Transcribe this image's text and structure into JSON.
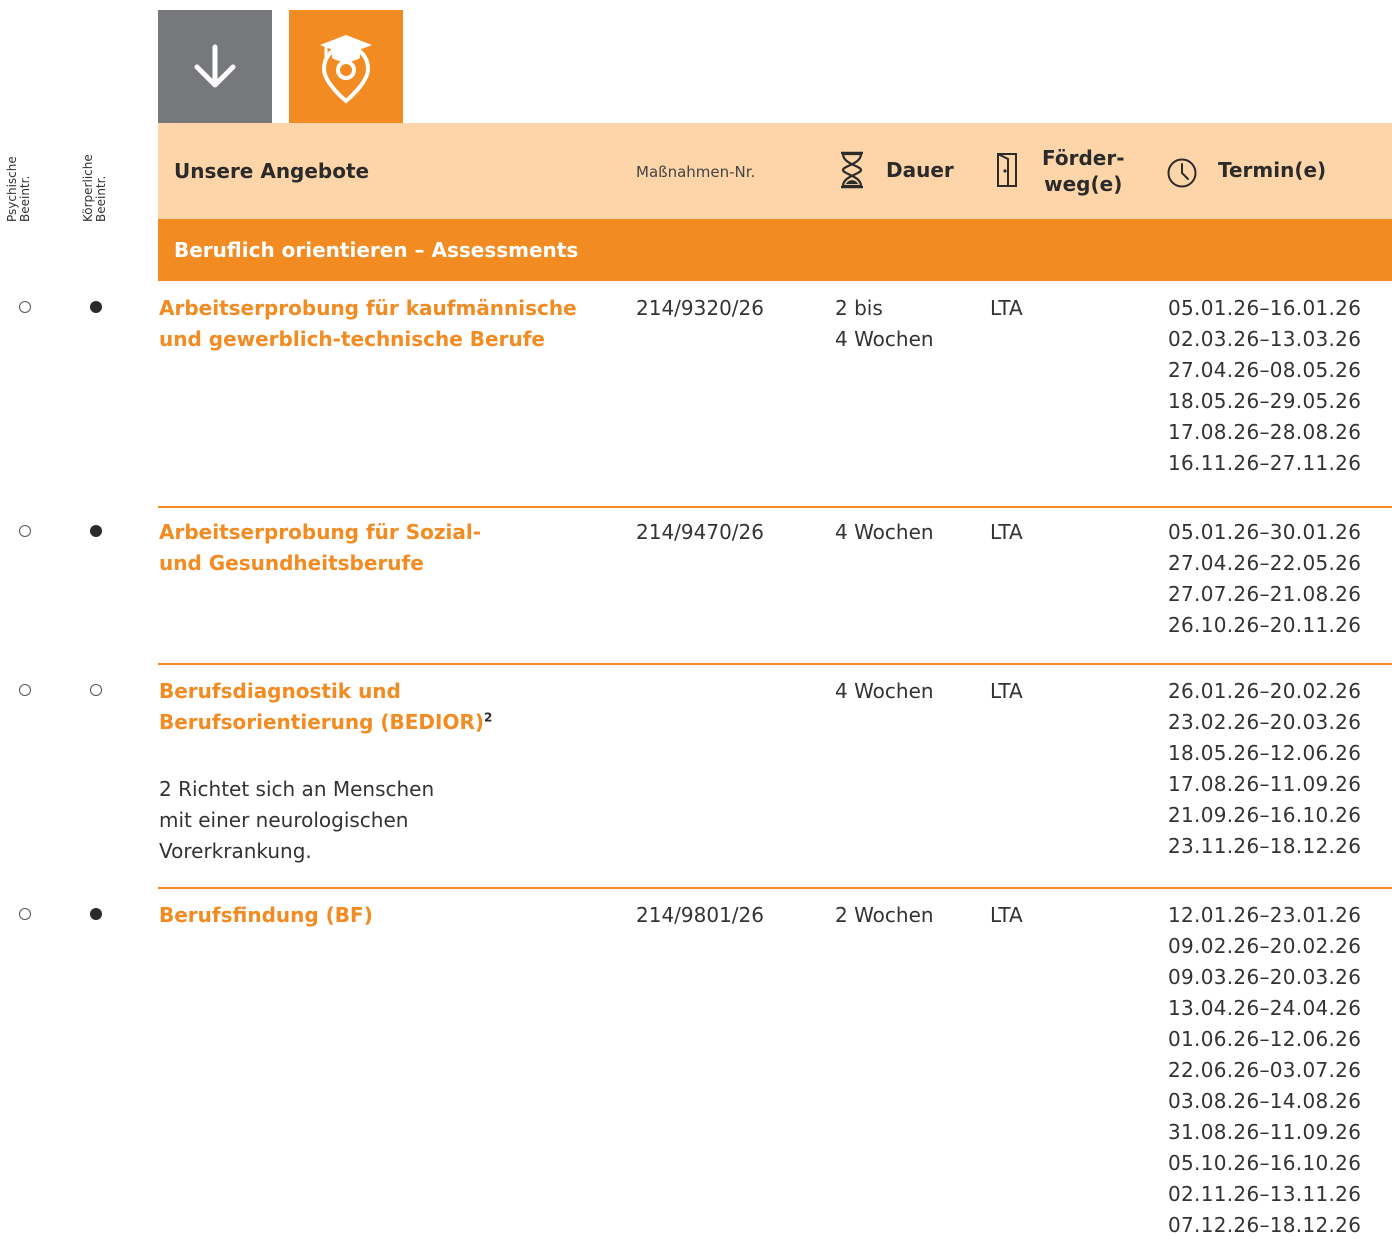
{
  "side_labels": [
    "Psychische Beeintr.",
    "Körperliche Beeintr."
  ],
  "header": {
    "angebote": "Unsere Angebote",
    "massnahmen": "Maßnahmen-Nr.",
    "dauer": "Dauer",
    "foerder_line1": "Förder-",
    "foerder_line2": "weg(e)",
    "termine": "Termin(e)"
  },
  "section": {
    "title": "Beruflich orientieren – Assessments"
  },
  "colors": {
    "accent": "#f28c22",
    "header_bg": "#fdd5a9",
    "gray_box": "#77787b"
  },
  "rows": [
    {
      "title_line1": "Arbeitserprobung für kaufmännische",
      "title_line2": "und gewerblich-technische Berufe",
      "title_sup": "",
      "psychisch": "open",
      "koerperlich": "filled",
      "nr": "214/9320/26",
      "dauer": "2 bis\n4 Wochen",
      "foerder": "LTA",
      "termine": [
        "05.01.26–16.01.26",
        "02.03.26–13.03.26",
        "27.04.26–08.05.26",
        "18.05.26–29.05.26",
        "17.08.26–28.08.26",
        "16.11.26–27.11.26"
      ],
      "note": ""
    },
    {
      "title_line1": "Arbeitserprobung für Sozial-",
      "title_line2": "und Gesundheitsberufe",
      "title_sup": "",
      "psychisch": "open",
      "koerperlich": "filled",
      "nr": "214/9470/26",
      "dauer": "4 Wochen",
      "foerder": "LTA",
      "termine": [
        "05.01.26–30.01.26",
        "27.04.26–22.05.26",
        "27.07.26–21.08.26",
        "26.10.26–20.11.26"
      ],
      "note": ""
    },
    {
      "title_line1": "Berufsdiagnostik und",
      "title_line2": "Berufsorientierung (BEDIOR)",
      "title_sup": "2",
      "psychisch": "open",
      "koerperlich": "open",
      "nr": "",
      "dauer": "4 Wochen",
      "foerder": "LTA",
      "termine": [
        "26.01.26–20.02.26",
        "23.02.26–20.03.26",
        "18.05.26–12.06.26",
        "17.08.26–11.09.26",
        "21.09.26–16.10.26",
        "23.11.26–18.12.26"
      ],
      "note": "2  Richtet sich an Menschen\n    mit einer neurologischen\n    Vorerkrankung."
    },
    {
      "title_line1": "Berufsfindung (BF)",
      "title_line2": "",
      "title_sup": "",
      "psychisch": "open",
      "koerperlich": "filled",
      "nr": "214/9801/26",
      "dauer": "2 Wochen",
      "foerder": "LTA",
      "termine": [
        "12.01.26–23.01.26",
        "09.02.26–20.02.26",
        "09.03.26–20.03.26",
        "13.04.26–24.04.26",
        "01.06.26–12.06.26",
        "22.06.26–03.07.26",
        "03.08.26–14.08.26",
        "31.08.26–11.09.26",
        "05.10.26–16.10.26",
        "02.11.26–13.11.26",
        "07.12.26–18.12.26"
      ],
      "note": ""
    }
  ]
}
